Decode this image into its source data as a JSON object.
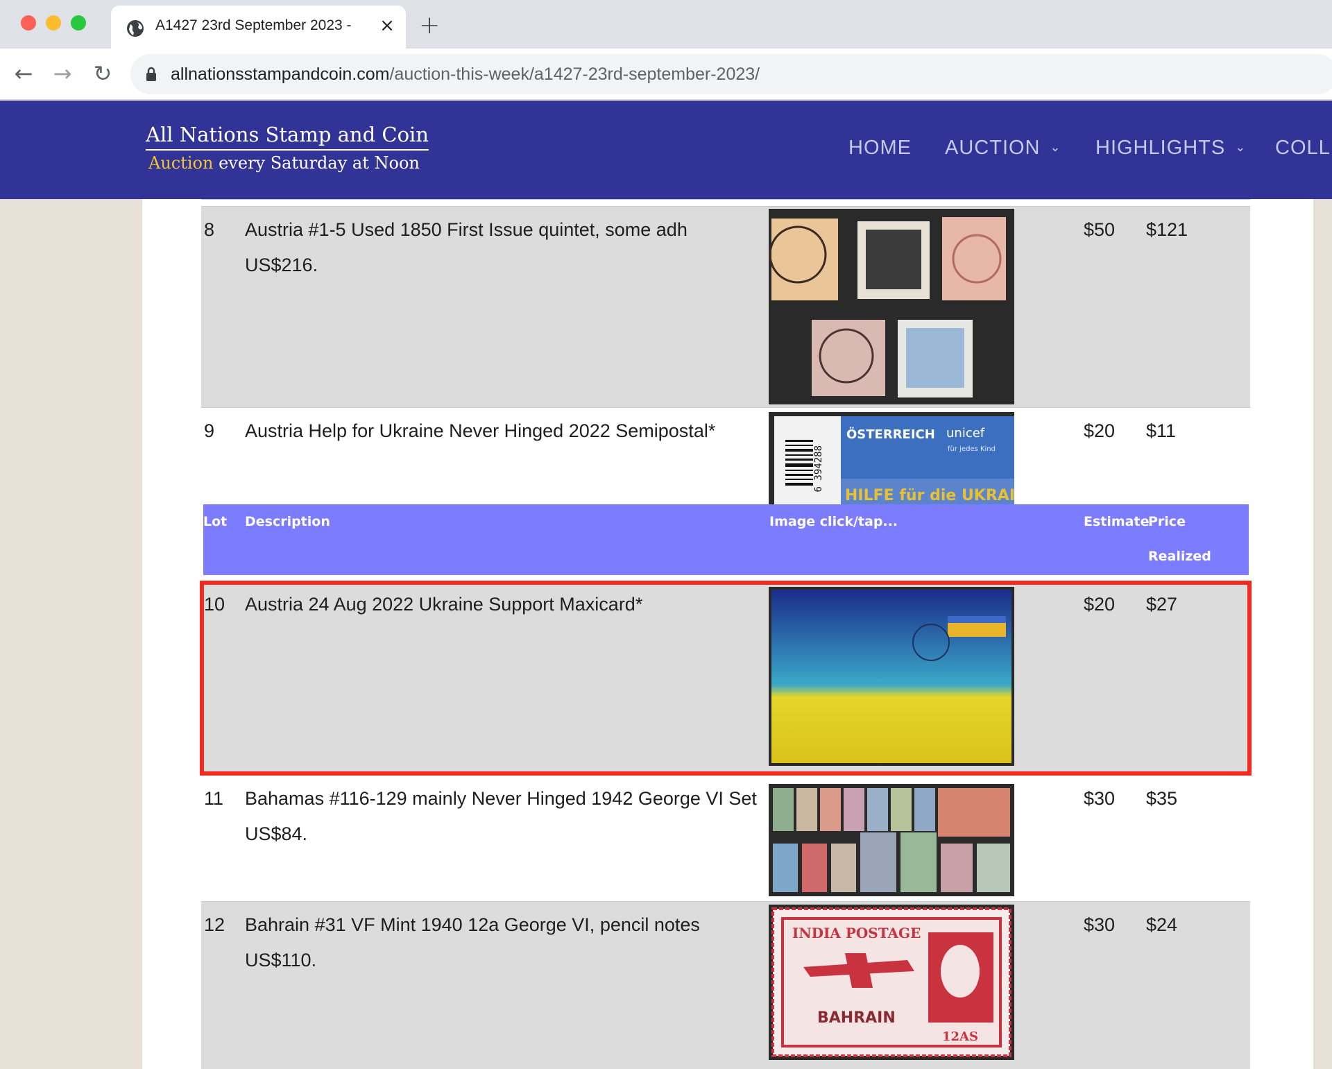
{
  "browser": {
    "tab_title": "A1427 23rd September 2023 -",
    "close_glyph": "×",
    "new_tab_glyph": "+",
    "back_glyph": "←",
    "forward_glyph": "→",
    "reload_glyph": "↻",
    "url_host": "allnationsstampandcoin.com",
    "url_path": "/auction-this-week/a1427-23rd-september-2023/"
  },
  "header": {
    "title": "All Nations Stamp and Coin",
    "tag_highlight": "Auction",
    "tag_rest": " every Saturday at Noon",
    "menu": {
      "home": "HOME",
      "auction": "AUCTION",
      "highlights": "HIGHLIGHTS",
      "colle": "COLLE"
    },
    "chevron": "⌄"
  },
  "table": {
    "headers": {
      "lot": "Lot",
      "description": "Description",
      "image": "Image click/tap...",
      "estimate": "Estimate",
      "price": "Price",
      "realized": "Realized"
    },
    "rows": [
      {
        "lot": "8",
        "description_line1": "Austria #1-5 Used 1850 First Issue quintet, some adh",
        "description_line2": "US$216.",
        "estimate": "$50",
        "price": "$121",
        "image": "austria-first-issue-stamps"
      },
      {
        "lot": "9",
        "description_line1": "Austria Help for Ukraine Never Hinged 2022 Semipostal*",
        "description_line2": "",
        "estimate": "$20",
        "price": "$11",
        "image": "austria-ukraine-semipostal"
      },
      {
        "lot": "10",
        "description_line1": "Austria 24 Aug 2022 Ukraine Support Maxicard*",
        "description_line2": "",
        "estimate": "$20",
        "price": "$27",
        "image": "ukraine-maxicard"
      },
      {
        "lot": "11",
        "description_line1": "Bahamas #116-129 mainly Never Hinged 1942 George VI Set",
        "description_line2": "US$84.",
        "estimate": "$30",
        "price": "$35",
        "image": "bahamas-george-vi-set"
      },
      {
        "lot": "12",
        "description_line1": "Bahrain #31 VF Mint 1940 12a George VI, pencil notes",
        "description_line2": "US$110.",
        "estimate": "$30",
        "price": "$24",
        "image": "bahrain-airmail-stamp"
      }
    ]
  },
  "stamp_text": {
    "osterreich": "ÖSTERREICH",
    "unicef": "unicef",
    "fur_jedes_kind": "für jedes Kind",
    "hilfe": "HILFE für die UKRAINE",
    "barcode_num": "6 394288",
    "india_postage": "INDIA POSTAGE",
    "bahrain": "BAHRAIN",
    "value": "12AS"
  },
  "colors": {
    "header_bg": "#323396",
    "table_header_bg": "#7b7cff",
    "highlight_border": "#f32a1d",
    "row_gray": "#dcdcdc"
  }
}
